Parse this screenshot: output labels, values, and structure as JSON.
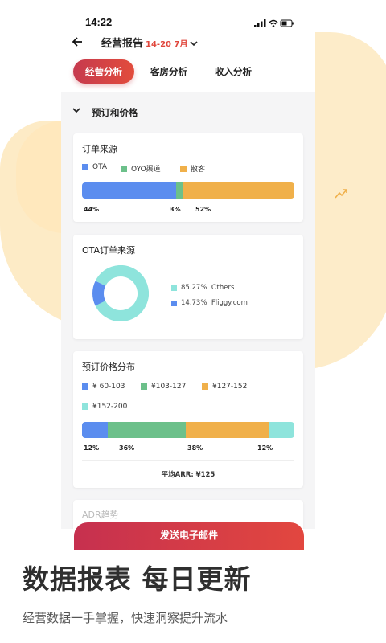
{
  "status": {
    "time": "14:22"
  },
  "header": {
    "title": "经营报告",
    "date_range": "14-20 7月"
  },
  "tabs": [
    {
      "label": "经营分析"
    },
    {
      "label": "客房分析"
    },
    {
      "label": "收入分析"
    }
  ],
  "section": {
    "label": "预订和价格"
  },
  "order_source": {
    "title": "订单来源",
    "legend": [
      {
        "label": "OTA",
        "color": "#5b8def"
      },
      {
        "label": "OYO渠道",
        "color": "#6cc08a"
      },
      {
        "label": "散客",
        "color": "#f0b04a"
      }
    ],
    "values": [
      44,
      3,
      52
    ],
    "labels": [
      "44%",
      "3%",
      "52%"
    ]
  },
  "ota_source": {
    "title": "OTA订单来源",
    "items": [
      {
        "pct": "85.27%",
        "name": "Others",
        "value": 85.27,
        "color": "#8ee4dc"
      },
      {
        "pct": "14.73%",
        "name": "Fliggy.com",
        "value": 14.73,
        "color": "#5b8def"
      }
    ]
  },
  "price_dist": {
    "title": "预订价格分布",
    "legend": [
      {
        "label": "¥ 60-103",
        "color": "#5b8def"
      },
      {
        "label": "¥103-127",
        "color": "#6cc08a"
      },
      {
        "label": "¥127-152",
        "color": "#f0b04a"
      },
      {
        "label": "¥152-200",
        "color": "#8ee4dc"
      }
    ],
    "values": [
      12,
      36,
      38,
      12
    ],
    "labels": [
      "12%",
      "36%",
      "38%",
      "12%"
    ],
    "avg": "平均ARR: ¥125"
  },
  "next_card": {
    "title": "ADR趋势"
  },
  "cta": {
    "label": "发送电子邮件"
  },
  "promo": {
    "headline": "数据报表 每日更新",
    "subline": "经营数据一手掌握，快速洞察提升流水"
  }
}
